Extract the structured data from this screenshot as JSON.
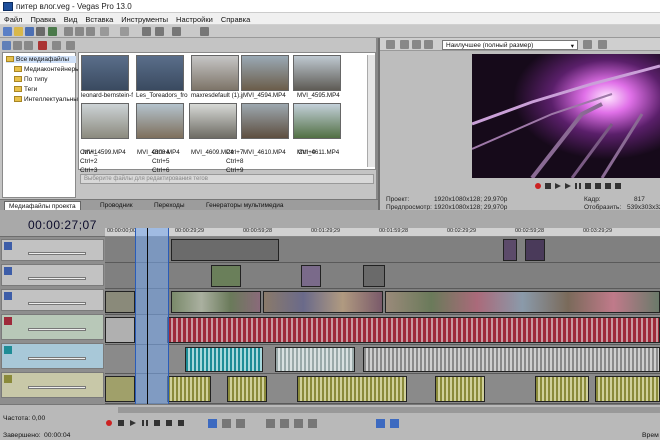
{
  "window": {
    "title": "питер влог.veg - Vegas Pro 13.0"
  },
  "menu": [
    "Файл",
    "Правка",
    "Вид",
    "Вставка",
    "Инструменты",
    "Настройки",
    "Справка"
  ],
  "explorer": {
    "tree": [
      "Все медиафайлы",
      "Медиаконтейнеры",
      "По типу",
      "Теги",
      "Интеллектуальные"
    ],
    "media": [
      {
        "name": "leonard-bernstein-feel-pretty-w..."
      },
      {
        "name": "Les_Toreadors_from_Carmen_b..."
      },
      {
        "name": "maxresdefault (1).jpg"
      },
      {
        "name": "MVI_4594.MP4"
      },
      {
        "name": "MVI_4595.MP4"
      },
      {
        "name": "MVI_4599.MP4"
      },
      {
        "name": "MVI_4608.MP4"
      },
      {
        "name": "MVI_4609.MP4"
      },
      {
        "name": "MVI_4610.MP4"
      },
      {
        "name": "MVI_4611.MP4"
      }
    ],
    "tag_placeholder": "Выберите файлы для редактирования тегов",
    "hotkeys": [
      "Ctrl+1",
      "Ctrl+2",
      "Ctrl+3",
      "Ctrl+4",
      "Ctrl+5",
      "Ctrl+6",
      "Ctrl+7",
      "Ctrl+8",
      "Ctrl+9",
      "Ctrl+0"
    ],
    "tabs": [
      "Медиафайлы проекта",
      "Проводник",
      "Переходы",
      "Генераторы мультимедиа"
    ]
  },
  "preview": {
    "quality": "Наилучшее (полный размер)",
    "project_label": "Проект:",
    "project_value": "1920x1080x128; 29,970p",
    "preview_label": "Предпросмотр:",
    "preview_value": "1920x1080x128; 29,970p",
    "frame_label": "Кадр:",
    "frame_value": "817",
    "display_label": "Отобразить:",
    "display_value": "539x303x32"
  },
  "timeline": {
    "timecode": "00:00:27;07",
    "ruler": [
      "00:00:00;00",
      "00:00:29;29",
      "00:00:59;28",
      "00:01:29;29",
      "00:01:59;28",
      "00:02:29;29",
      "00:02:59;28",
      "00:03:29;29",
      "00:03:59;28"
    ]
  },
  "status": {
    "rate_label": "Частота:",
    "rate_value": "0,00",
    "complete_label": "Завершено:",
    "complete_value": "00:00:04",
    "time_short": "Врем"
  },
  "colors": {
    "accent": "#2a5cb8",
    "video_clip": "#6a7f5a",
    "audio_clip": "#9e2a3a",
    "audio2": "#1e8c96",
    "audio3": "#8a8a3a"
  }
}
